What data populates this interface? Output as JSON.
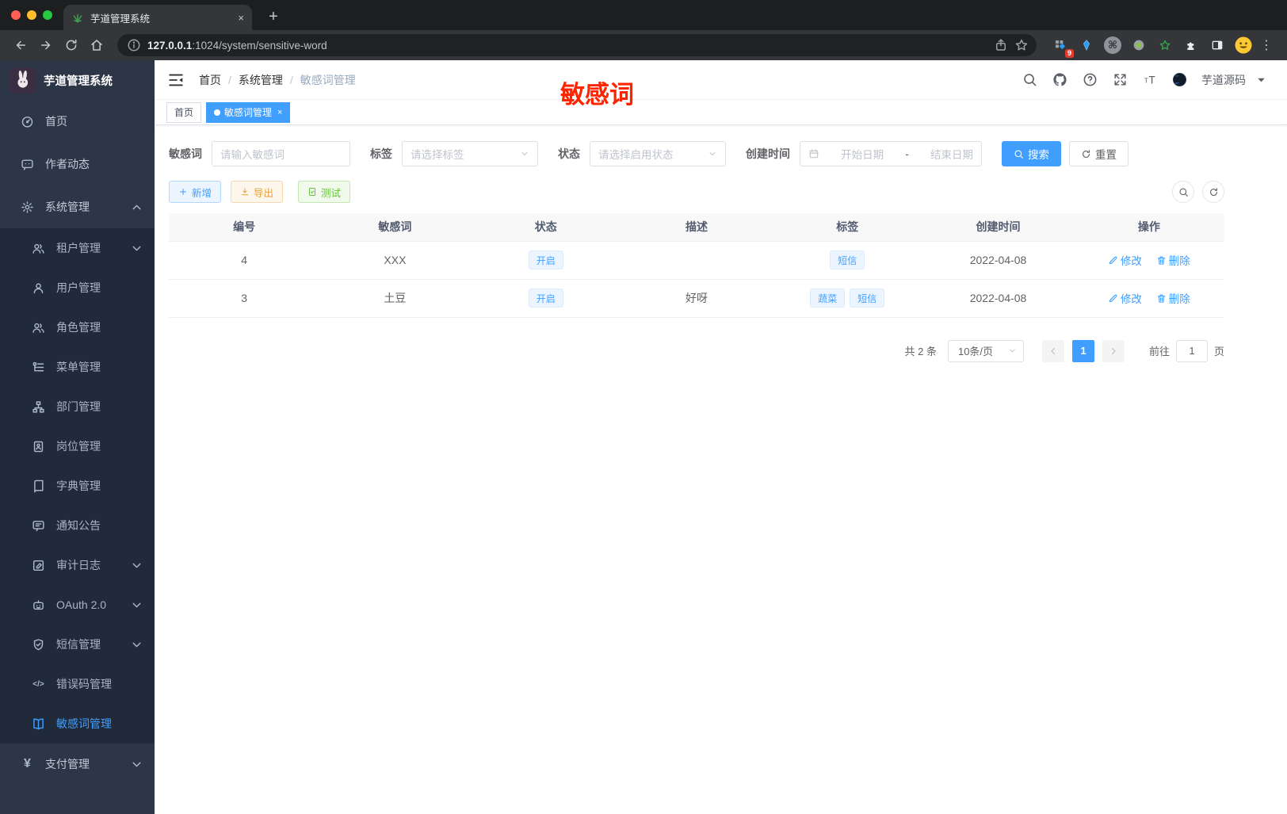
{
  "colors": {
    "primary": "#409eff",
    "warning": "#e6a23c",
    "success": "#67c23a",
    "annotation": "#ff2400",
    "sidebarBg": "#2d3647",
    "submenuBg": "#212a3a"
  },
  "browser": {
    "tab_title": "芋道管理系统",
    "close_glyph": "×",
    "new_tab_glyph": "+",
    "url_host": "127.0.0.1",
    "url_path": ":1024/system/sensitive-word",
    "extension_badge": "9",
    "cmd_glyph": "⌘",
    "dots_glyph": "⋮"
  },
  "sidebar": {
    "app_title": "芋道管理系统",
    "top_items": [
      {
        "label": "首页",
        "icon": "dashboard-icon"
      },
      {
        "label": "作者动态",
        "icon": "message-icon"
      },
      {
        "label": "系统管理",
        "icon": "gear-icon",
        "chevron": "up"
      }
    ],
    "sub_items": [
      {
        "label": "租户管理",
        "icon": "people-icon",
        "chevron": "down"
      },
      {
        "label": "用户管理",
        "icon": "user-icon"
      },
      {
        "label": "角色管理",
        "icon": "people-icon"
      },
      {
        "label": "菜单管理",
        "icon": "menu-tree-icon"
      },
      {
        "label": "部门管理",
        "icon": "org-icon"
      },
      {
        "label": "岗位管理",
        "icon": "badge-icon"
      },
      {
        "label": "字典管理",
        "icon": "book-icon"
      },
      {
        "label": "通知公告",
        "icon": "notice-icon"
      },
      {
        "label": "审计日志",
        "icon": "log-icon",
        "chevron": "down"
      },
      {
        "label": "OAuth 2.0",
        "icon": "robot-icon",
        "chevron": "down"
      },
      {
        "label": "短信管理",
        "icon": "shield-icon",
        "chevron": "down"
      },
      {
        "label": "错误码管理",
        "icon": "code-icon",
        "glyph": "</>"
      },
      {
        "label": "敏感词管理",
        "icon": "open-book-icon",
        "active": true
      }
    ],
    "bottom_items": [
      {
        "label": "支付管理",
        "icon": "yen-icon",
        "glyph": "¥",
        "chevron": "down"
      }
    ]
  },
  "navbar": {
    "breadcrumb": [
      "首页",
      "系统管理",
      "敏感词管理"
    ],
    "breadcrumb_sep": "/",
    "user_name": "芋道源码"
  },
  "annotation": {
    "text": "敏感词"
  },
  "tags_view": [
    {
      "label": "首页"
    },
    {
      "label": "敏感词管理",
      "close_glyph": "×"
    }
  ],
  "filters": {
    "keyword_label": "敏感词",
    "keyword_placeholder": "请输入敏感词",
    "tag_label": "标签",
    "tag_placeholder": "请选择标签",
    "status_label": "状态",
    "status_placeholder": "请选择启用状态",
    "date_label": "创建时间",
    "date_start_placeholder": "开始日期",
    "date_separator": "-",
    "date_end_placeholder": "结束日期",
    "search_label": "搜索",
    "reset_label": "重置"
  },
  "toolbar": {
    "add_label": "新增",
    "export_label": "导出",
    "test_label": "测试"
  },
  "table": {
    "columns": [
      "编号",
      "敏感词",
      "状态",
      "描述",
      "标签",
      "创建时间",
      "操作"
    ],
    "edit_label": "修改",
    "delete_label": "删除",
    "rows": [
      {
        "id": "4",
        "word": "XXX",
        "status": "开启",
        "description": "",
        "tags": [
          "短信"
        ],
        "created": "2022-04-08"
      },
      {
        "id": "3",
        "word": "土豆",
        "status": "开启",
        "description": "好呀",
        "tags": [
          "蔬菜",
          "短信"
        ],
        "created": "2022-04-08"
      }
    ]
  },
  "pagination": {
    "total_text": "共 2 条",
    "page_size_text": "10条/页",
    "current_page": "1",
    "goto_label": "前往",
    "goto_value": "1",
    "page_unit": "页"
  }
}
